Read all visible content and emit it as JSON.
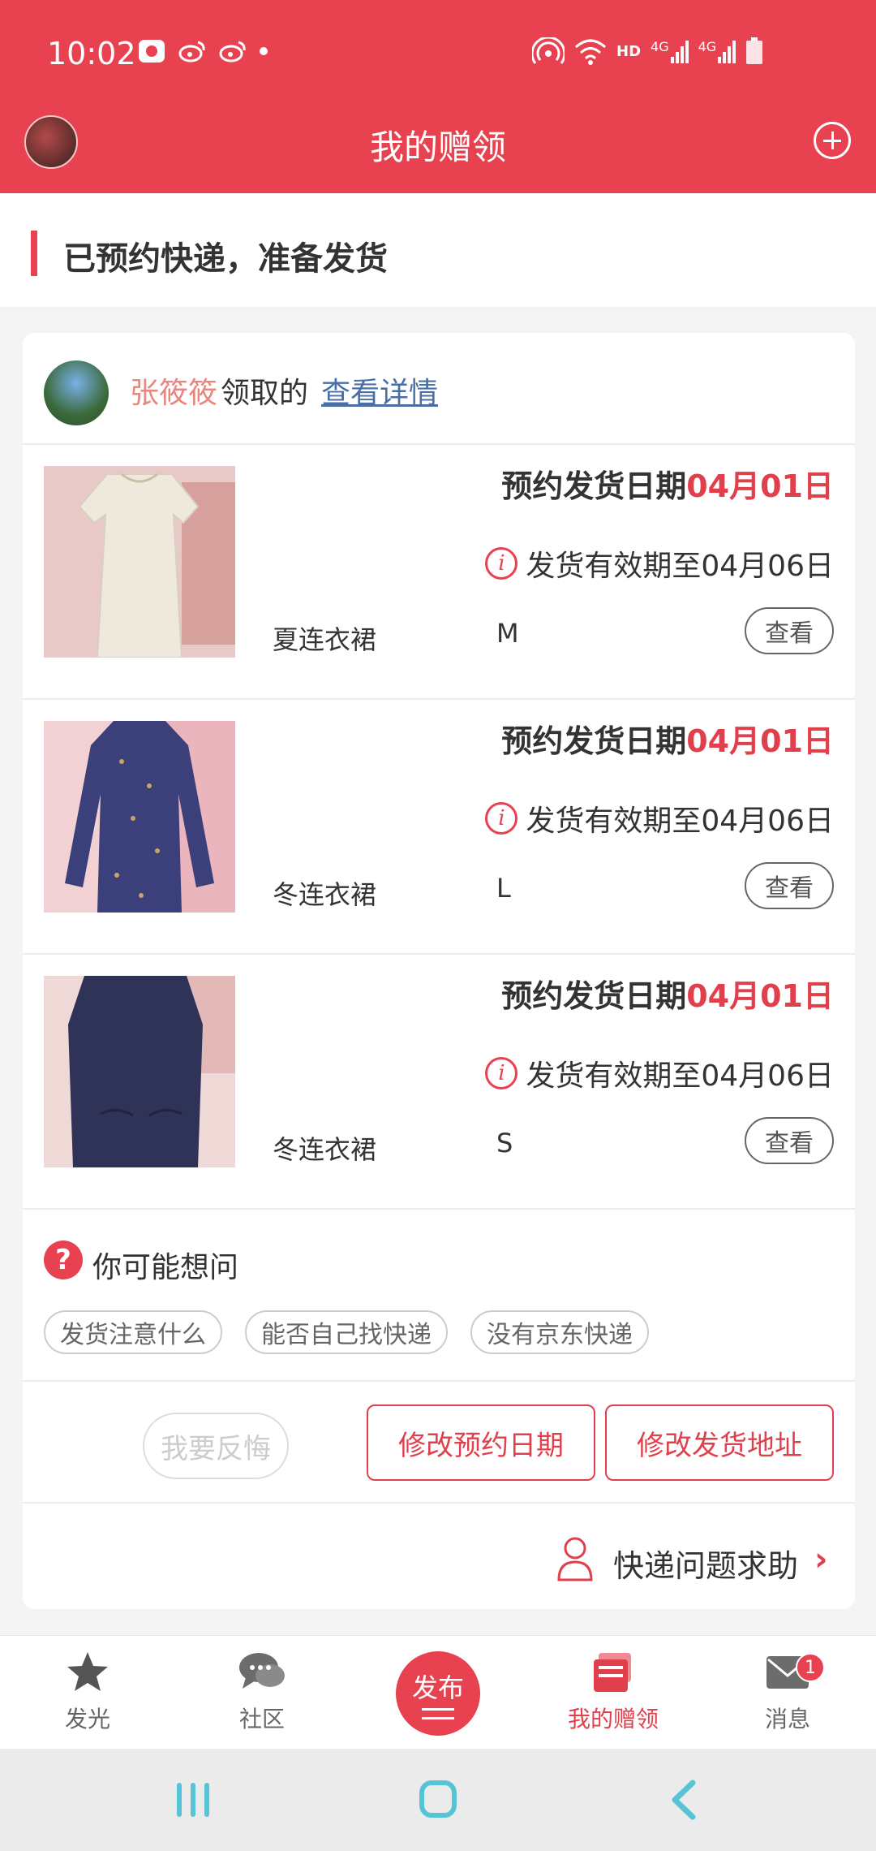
{
  "status_bar": {
    "time": "10:02",
    "icons": [
      "app-notification-icon",
      "weibo-icon",
      "weibo-icon",
      "dot-icon",
      "hotspot-icon",
      "wifi-icon",
      "hd-icon",
      "4g-signal-icon",
      "4g-signal-icon",
      "battery-icon"
    ],
    "hd_label": "HD",
    "net1": "4G",
    "net2": "4G"
  },
  "header": {
    "title": "我的赠领",
    "accent_color": "#e8414f"
  },
  "section": {
    "title": "已预约快递，准备发货"
  },
  "receiver": {
    "name": "张筱筱",
    "action_text": "领取的",
    "detail_link": "查看详情"
  },
  "items": [
    {
      "date_label": "预约发货日期",
      "date_value": "04月01日",
      "valid_text": "发货有效期至04月06日",
      "name": "夏连衣裙",
      "size": "M",
      "view_label": "查看"
    },
    {
      "date_label": "预约发货日期",
      "date_value": "04月01日",
      "valid_text": "发货有效期至04月06日",
      "name": "冬连衣裙",
      "size": "L",
      "view_label": "查看"
    },
    {
      "date_label": "预约发货日期",
      "date_value": "04月01日",
      "valid_text": "发货有效期至04月06日",
      "name": "冬连衣裙",
      "size": "S",
      "view_label": "查看"
    }
  ],
  "faq": {
    "title": "你可能想问",
    "chips": [
      "发货注意什么",
      "能否自己找快递",
      "没有京东快递"
    ]
  },
  "actions": {
    "regret": "我要反悔",
    "change_date": "修改预约日期",
    "change_address": "修改发货地址"
  },
  "help": {
    "label": "快递问题求助"
  },
  "tabbar": {
    "tabs": [
      {
        "label": "发光",
        "icon": "star-icon"
      },
      {
        "label": "社区",
        "icon": "chat-bubbles-icon"
      },
      {
        "label": "发布",
        "icon": "publish-icon"
      },
      {
        "label": "我的赠领",
        "icon": "gift-box-icon"
      },
      {
        "label": "消息",
        "icon": "envelope-icon"
      }
    ],
    "message_badge": "1",
    "active_tab": "我的赠领"
  }
}
